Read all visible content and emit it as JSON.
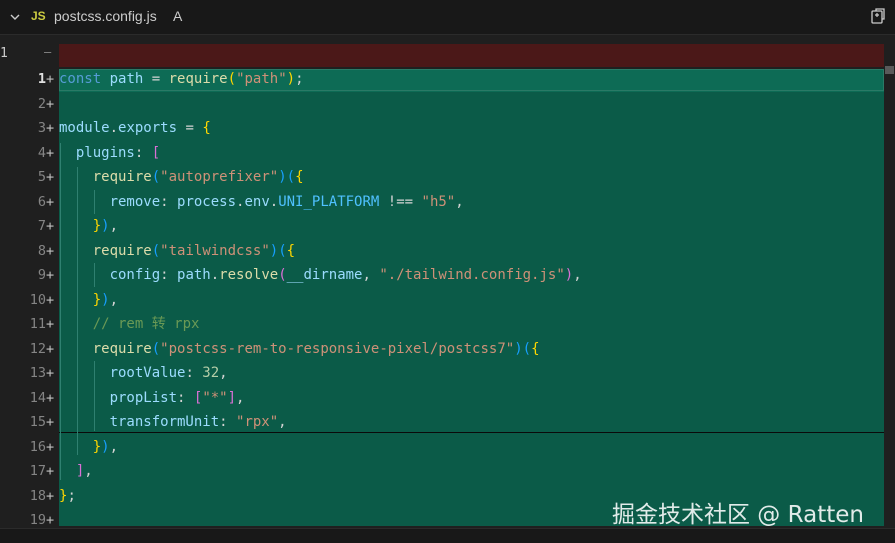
{
  "file": {
    "language_badge": "JS",
    "name": "postcss.config.js",
    "git_status": "A"
  },
  "removed_side": {
    "line_number": "1",
    "marker": "—"
  },
  "line_numbers": [
    "1",
    "2",
    "3",
    "4",
    "5",
    "6",
    "7",
    "8",
    "9",
    "10",
    "11",
    "12",
    "13",
    "14",
    "15",
    "16",
    "17",
    "18",
    "19"
  ],
  "diff_marker": "+",
  "code": {
    "l1_const": "const",
    "l1_path": "path",
    "l1_eq": " = ",
    "l1_require": "require",
    "l1_lp": "(",
    "l1_str": "\"path\"",
    "l1_rp": ")",
    "l1_semi": ";",
    "l3_module": "module",
    "l3_dot": ".",
    "l3_exports": "exports",
    "l3_eq": " = ",
    "l3_brace": "{",
    "l4_plugins": "plugins",
    "l4_colon": ": ",
    "l4_bracket": "[",
    "l5_require": "require",
    "l5_lp": "(",
    "l5_str": "\"autoprefixer\"",
    "l5_rp": ")",
    "l5_lp2": "(",
    "l5_brace": "{",
    "l6_remove": "remove",
    "l6_colon": ": ",
    "l6_process": "process",
    "l6_dot1": ".",
    "l6_env": "env",
    "l6_dot2": ".",
    "l6_const": "UNI_PLATFORM",
    "l6_op": " !== ",
    "l6_str": "\"h5\"",
    "l6_comma": ",",
    "l7_brace": "}",
    "l7_rp": ")",
    "l7_comma": ",",
    "l8_require": "require",
    "l8_lp": "(",
    "l8_str": "\"tailwindcss\"",
    "l8_rp": ")",
    "l8_lp2": "(",
    "l8_brace": "{",
    "l9_config": "config",
    "l9_colon": ": ",
    "l9_path": "path",
    "l9_dot": ".",
    "l9_resolve": "resolve",
    "l9_lp": "(",
    "l9_dirname": "__dirname",
    "l9_comma": ", ",
    "l9_str": "\"./tailwind.config.js\"",
    "l9_rp": ")",
    "l9_comma2": ",",
    "l10_brace": "}",
    "l10_rp": ")",
    "l10_comma": ",",
    "l11_comment": "// rem 转 rpx",
    "l12_require": "require",
    "l12_lp": "(",
    "l12_str": "\"postcss-rem-to-responsive-pixel/postcss7\"",
    "l12_rp": ")",
    "l12_lp2": "(",
    "l12_brace": "{",
    "l13_key": "rootValue",
    "l13_colon": ": ",
    "l13_num": "32",
    "l13_comma": ",",
    "l14_key": "propList",
    "l14_colon": ": ",
    "l14_lb": "[",
    "l14_str": "\"*\"",
    "l14_rb": "]",
    "l14_comma": ",",
    "l15_key": "transformUnit",
    "l15_colon": ": ",
    "l15_str": "\"rpx\"",
    "l15_comma": ",",
    "l16_brace": "}",
    "l16_rp": ")",
    "l16_comma": ",",
    "l17_bracket": "]",
    "l17_comma": ",",
    "l18_brace": "}",
    "l18_semi": ";"
  },
  "watermark": "掘金技术社区 @ Ratten",
  "colors": {
    "added_background": "#0b5b48",
    "removed_background": "#4b1818",
    "editor_background": "#1f1f1f"
  }
}
